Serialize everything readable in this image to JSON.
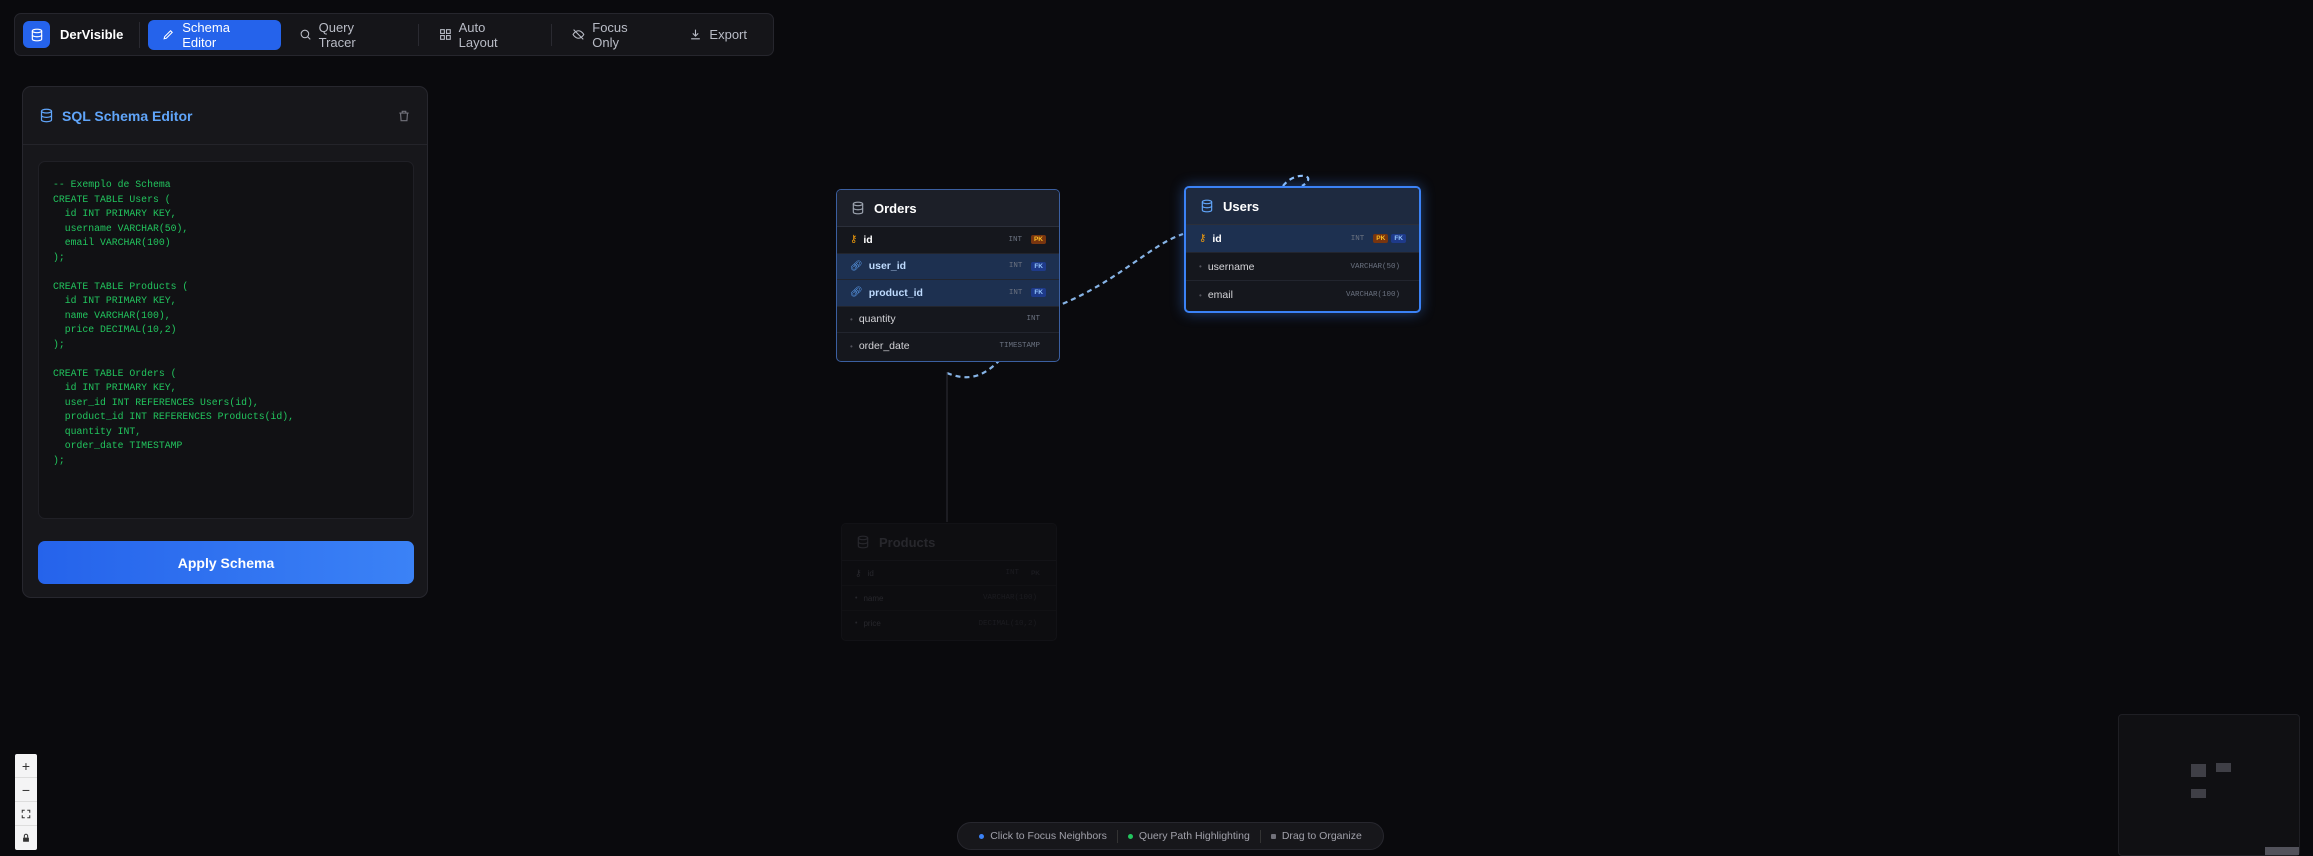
{
  "app": {
    "name": "DerVisible"
  },
  "toolbar": {
    "schema_editor": "Schema Editor",
    "query_tracer": "Query Tracer",
    "auto_layout": "Auto Layout",
    "focus_only": "Focus Only",
    "export": "Export"
  },
  "editor": {
    "title": "SQL Schema Editor",
    "code": "-- Exemplo de Schema\nCREATE TABLE Users (\n  id INT PRIMARY KEY,\n  username VARCHAR(50),\n  email VARCHAR(100)\n);\n\nCREATE TABLE Products (\n  id INT PRIMARY KEY,\n  name VARCHAR(100),\n  price DECIMAL(10,2)\n);\n\nCREATE TABLE Orders (\n  id INT PRIMARY KEY,\n  user_id INT REFERENCES Users(id),\n  product_id INT REFERENCES Products(id),\n  quantity INT,\n  order_date TIMESTAMP\n);",
    "apply_label": "Apply Schema"
  },
  "tables": {
    "orders": {
      "name": "Orders",
      "columns": [
        {
          "name": "id",
          "type": "INT",
          "badges": [
            "PK"
          ]
        },
        {
          "name": "user_id",
          "type": "INT",
          "badges": [
            "FK"
          ]
        },
        {
          "name": "product_id",
          "type": "INT",
          "badges": [
            "FK"
          ]
        },
        {
          "name": "quantity",
          "type": "INT",
          "badges": []
        },
        {
          "name": "order_date",
          "type": "TIMESTAMP",
          "badges": []
        }
      ]
    },
    "users": {
      "name": "Users",
      "columns": [
        {
          "name": "id",
          "type": "INT",
          "badges": [
            "PK",
            "FK"
          ]
        },
        {
          "name": "username",
          "type": "VARCHAR(50)",
          "badges": []
        },
        {
          "name": "email",
          "type": "VARCHAR(100)",
          "badges": []
        }
      ]
    },
    "products": {
      "name": "Products",
      "columns": [
        {
          "name": "id",
          "type": "INT",
          "badges": [
            "PK"
          ]
        },
        {
          "name": "name",
          "type": "VARCHAR(100)",
          "badges": []
        },
        {
          "name": "price",
          "type": "DECIMAL(10,2)",
          "badges": []
        }
      ]
    }
  },
  "legend": {
    "item1": "Click to Focus Neighbors",
    "item2": "Query Path Highlighting",
    "item3": "Drag to Organize"
  },
  "zoom_controls": {
    "plus": "+",
    "minus": "−"
  },
  "colors": {
    "accent": "#2563eb",
    "pk": "#f59e0b",
    "fk": "#60a5fa",
    "code": "#22c55e"
  }
}
